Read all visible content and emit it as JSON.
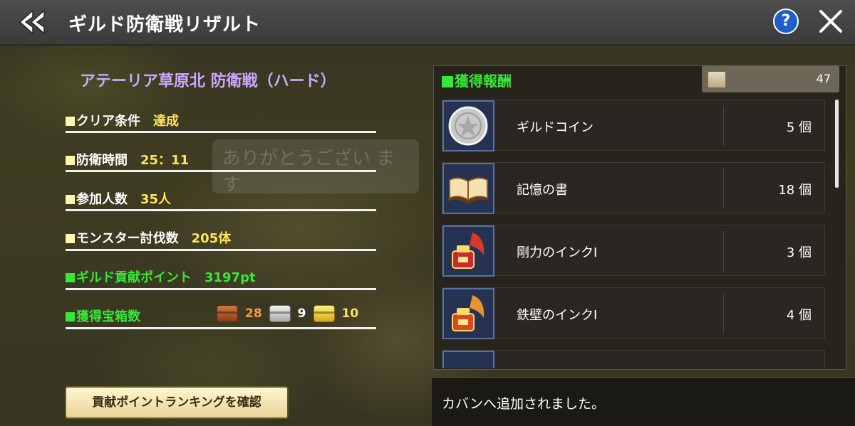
{
  "header": {
    "title": "ギルド防衛戦リザルト",
    "help_label": "?"
  },
  "result": {
    "stage_title": "アテーリア草原北 防衛戦（ハード）",
    "stats": [
      {
        "label": "クリア条件",
        "value": "達成"
      },
      {
        "label": "防衛時間",
        "value": "25：11"
      },
      {
        "label": "参加人数",
        "value": "35人"
      },
      {
        "label": "モンスター討伐数",
        "value": "205体"
      }
    ],
    "guild_points": {
      "label": "ギルド貢献ポイント",
      "value": "3197pt"
    },
    "chests": {
      "label": "獲得宝箱数",
      "bronze": "28",
      "silver": "9",
      "gold": "10"
    },
    "ranking_button": "貢献ポイントランキングを確認"
  },
  "rewards": {
    "header": "獲得報酬",
    "bag_count": "47",
    "items": [
      {
        "name": "ギルドコイン",
        "qty": "5 個",
        "icon": "coin-icon"
      },
      {
        "name": "記憶の書",
        "qty": "18 個",
        "icon": "book-icon"
      },
      {
        "name": "剛力のインクⅠ",
        "qty": "3 個",
        "icon": "ink-icon"
      },
      {
        "name": "鉄壁のインクⅠ",
        "qty": "4 個",
        "icon": "ink-icon"
      }
    ]
  },
  "background_chat": "ありがとうござい ます",
  "toast": "カバンへ追加されました。",
  "colors": {
    "accent_green": "#37e83a",
    "value_yellow": "#ffe45a",
    "stage_purple": "#c9a9ff",
    "help_blue": "#1f5fc9"
  }
}
